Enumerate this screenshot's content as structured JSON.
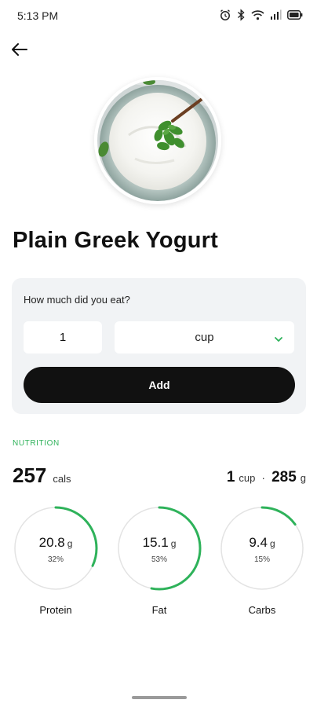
{
  "status_bar": {
    "time": "5:13 PM",
    "icons": [
      "alarm-icon",
      "bluetooth-icon",
      "wifi-icon",
      "signal-icon",
      "battery-icon"
    ]
  },
  "nav": {
    "back_icon": "arrow-left-icon"
  },
  "food": {
    "title": "Plain Greek Yogurt",
    "image": "greek-yogurt-bowl-photo"
  },
  "portion": {
    "question": "How much did you eat?",
    "quantity_value": "1",
    "unit_selected": "cup",
    "add_label": "Add"
  },
  "nutrition": {
    "heading": "NUTRITION",
    "calories": "257",
    "calories_unit": "cals",
    "serving_qty": "1",
    "serving_unit": "cup",
    "serving_separator": "·",
    "serving_grams": "285",
    "serving_grams_unit": "g",
    "macros": [
      {
        "name": "Protein",
        "value": "20.8",
        "unit": "g",
        "percent_label": "32%",
        "percent": 32
      },
      {
        "name": "Fat",
        "value": "15.1",
        "unit": "g",
        "percent_label": "53%",
        "percent": 53
      },
      {
        "name": "Carbs",
        "value": "9.4",
        "unit": "g",
        "percent_label": "15%",
        "percent": 15
      }
    ]
  },
  "colors": {
    "accent_green": "#2eb25a",
    "ring_track": "#e3e3e3",
    "card_bg": "#f1f3f5",
    "button_bg": "#111111"
  }
}
